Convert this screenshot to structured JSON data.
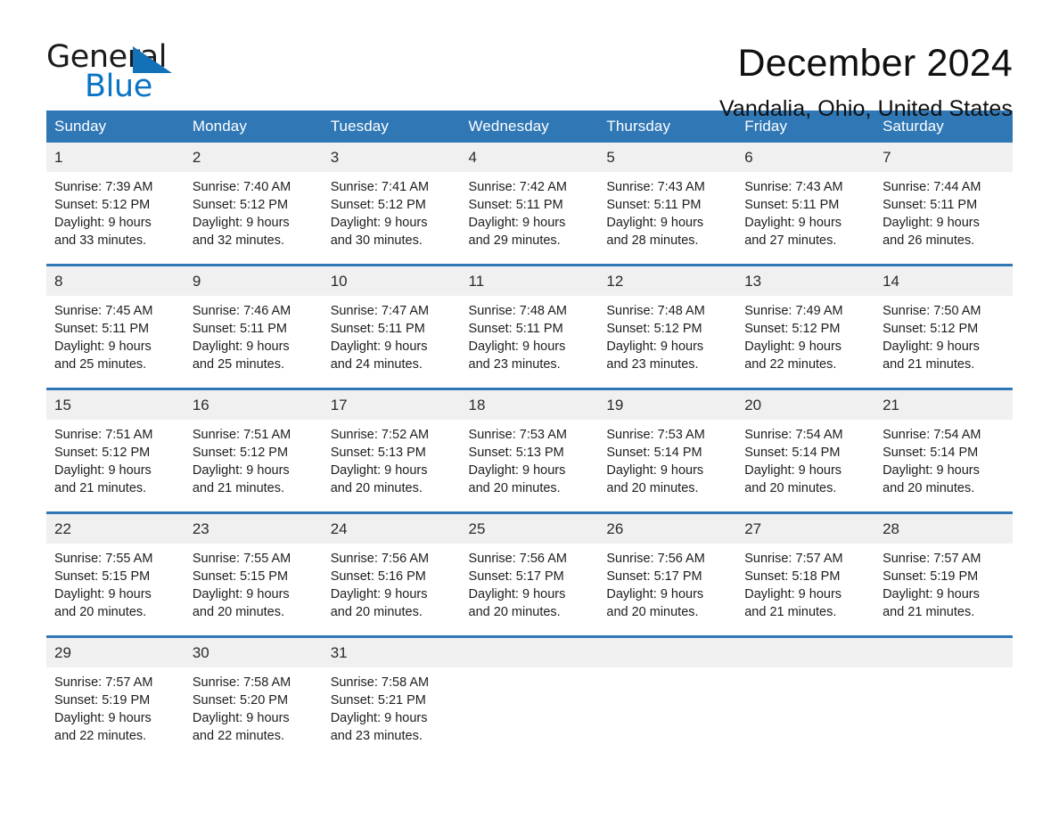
{
  "brand": {
    "name_part1": "General",
    "name_part2": "Blue",
    "triangle_color": "#1371b8",
    "blue_text_color": "#0b74c4"
  },
  "header": {
    "title": "December 2024",
    "subtitle": "Vandalia, Ohio, United States"
  },
  "theme": {
    "header_blue": "#2f77b5",
    "daynum_band": "#f0f0f0",
    "row_divider": "#2f77b5"
  },
  "calendar": {
    "weekday_headers": [
      "Sunday",
      "Monday",
      "Tuesday",
      "Wednesday",
      "Thursday",
      "Friday",
      "Saturday"
    ],
    "weeks": [
      [
        {
          "day": "1",
          "sunrise": "Sunrise: 7:39 AM",
          "sunset": "Sunset: 5:12 PM",
          "daylight1": "Daylight: 9 hours",
          "daylight2": "and 33 minutes."
        },
        {
          "day": "2",
          "sunrise": "Sunrise: 7:40 AM",
          "sunset": "Sunset: 5:12 PM",
          "daylight1": "Daylight: 9 hours",
          "daylight2": "and 32 minutes."
        },
        {
          "day": "3",
          "sunrise": "Sunrise: 7:41 AM",
          "sunset": "Sunset: 5:12 PM",
          "daylight1": "Daylight: 9 hours",
          "daylight2": "and 30 minutes."
        },
        {
          "day": "4",
          "sunrise": "Sunrise: 7:42 AM",
          "sunset": "Sunset: 5:11 PM",
          "daylight1": "Daylight: 9 hours",
          "daylight2": "and 29 minutes."
        },
        {
          "day": "5",
          "sunrise": "Sunrise: 7:43 AM",
          "sunset": "Sunset: 5:11 PM",
          "daylight1": "Daylight: 9 hours",
          "daylight2": "and 28 minutes."
        },
        {
          "day": "6",
          "sunrise": "Sunrise: 7:43 AM",
          "sunset": "Sunset: 5:11 PM",
          "daylight1": "Daylight: 9 hours",
          "daylight2": "and 27 minutes."
        },
        {
          "day": "7",
          "sunrise": "Sunrise: 7:44 AM",
          "sunset": "Sunset: 5:11 PM",
          "daylight1": "Daylight: 9 hours",
          "daylight2": "and 26 minutes."
        }
      ],
      [
        {
          "day": "8",
          "sunrise": "Sunrise: 7:45 AM",
          "sunset": "Sunset: 5:11 PM",
          "daylight1": "Daylight: 9 hours",
          "daylight2": "and 25 minutes."
        },
        {
          "day": "9",
          "sunrise": "Sunrise: 7:46 AM",
          "sunset": "Sunset: 5:11 PM",
          "daylight1": "Daylight: 9 hours",
          "daylight2": "and 25 minutes."
        },
        {
          "day": "10",
          "sunrise": "Sunrise: 7:47 AM",
          "sunset": "Sunset: 5:11 PM",
          "daylight1": "Daylight: 9 hours",
          "daylight2": "and 24 minutes."
        },
        {
          "day": "11",
          "sunrise": "Sunrise: 7:48 AM",
          "sunset": "Sunset: 5:11 PM",
          "daylight1": "Daylight: 9 hours",
          "daylight2": "and 23 minutes."
        },
        {
          "day": "12",
          "sunrise": "Sunrise: 7:48 AM",
          "sunset": "Sunset: 5:12 PM",
          "daylight1": "Daylight: 9 hours",
          "daylight2": "and 23 minutes."
        },
        {
          "day": "13",
          "sunrise": "Sunrise: 7:49 AM",
          "sunset": "Sunset: 5:12 PM",
          "daylight1": "Daylight: 9 hours",
          "daylight2": "and 22 minutes."
        },
        {
          "day": "14",
          "sunrise": "Sunrise: 7:50 AM",
          "sunset": "Sunset: 5:12 PM",
          "daylight1": "Daylight: 9 hours",
          "daylight2": "and 21 minutes."
        }
      ],
      [
        {
          "day": "15",
          "sunrise": "Sunrise: 7:51 AM",
          "sunset": "Sunset: 5:12 PM",
          "daylight1": "Daylight: 9 hours",
          "daylight2": "and 21 minutes."
        },
        {
          "day": "16",
          "sunrise": "Sunrise: 7:51 AM",
          "sunset": "Sunset: 5:12 PM",
          "daylight1": "Daylight: 9 hours",
          "daylight2": "and 21 minutes."
        },
        {
          "day": "17",
          "sunrise": "Sunrise: 7:52 AM",
          "sunset": "Sunset: 5:13 PM",
          "daylight1": "Daylight: 9 hours",
          "daylight2": "and 20 minutes."
        },
        {
          "day": "18",
          "sunrise": "Sunrise: 7:53 AM",
          "sunset": "Sunset: 5:13 PM",
          "daylight1": "Daylight: 9 hours",
          "daylight2": "and 20 minutes."
        },
        {
          "day": "19",
          "sunrise": "Sunrise: 7:53 AM",
          "sunset": "Sunset: 5:14 PM",
          "daylight1": "Daylight: 9 hours",
          "daylight2": "and 20 minutes."
        },
        {
          "day": "20",
          "sunrise": "Sunrise: 7:54 AM",
          "sunset": "Sunset: 5:14 PM",
          "daylight1": "Daylight: 9 hours",
          "daylight2": "and 20 minutes."
        },
        {
          "day": "21",
          "sunrise": "Sunrise: 7:54 AM",
          "sunset": "Sunset: 5:14 PM",
          "daylight1": "Daylight: 9 hours",
          "daylight2": "and 20 minutes."
        }
      ],
      [
        {
          "day": "22",
          "sunrise": "Sunrise: 7:55 AM",
          "sunset": "Sunset: 5:15 PM",
          "daylight1": "Daylight: 9 hours",
          "daylight2": "and 20 minutes."
        },
        {
          "day": "23",
          "sunrise": "Sunrise: 7:55 AM",
          "sunset": "Sunset: 5:15 PM",
          "daylight1": "Daylight: 9 hours",
          "daylight2": "and 20 minutes."
        },
        {
          "day": "24",
          "sunrise": "Sunrise: 7:56 AM",
          "sunset": "Sunset: 5:16 PM",
          "daylight1": "Daylight: 9 hours",
          "daylight2": "and 20 minutes."
        },
        {
          "day": "25",
          "sunrise": "Sunrise: 7:56 AM",
          "sunset": "Sunset: 5:17 PM",
          "daylight1": "Daylight: 9 hours",
          "daylight2": "and 20 minutes."
        },
        {
          "day": "26",
          "sunrise": "Sunrise: 7:56 AM",
          "sunset": "Sunset: 5:17 PM",
          "daylight1": "Daylight: 9 hours",
          "daylight2": "and 20 minutes."
        },
        {
          "day": "27",
          "sunrise": "Sunrise: 7:57 AM",
          "sunset": "Sunset: 5:18 PM",
          "daylight1": "Daylight: 9 hours",
          "daylight2": "and 21 minutes."
        },
        {
          "day": "28",
          "sunrise": "Sunrise: 7:57 AM",
          "sunset": "Sunset: 5:19 PM",
          "daylight1": "Daylight: 9 hours",
          "daylight2": "and 21 minutes."
        }
      ],
      [
        {
          "day": "29",
          "sunrise": "Sunrise: 7:57 AM",
          "sunset": "Sunset: 5:19 PM",
          "daylight1": "Daylight: 9 hours",
          "daylight2": "and 22 minutes."
        },
        {
          "day": "30",
          "sunrise": "Sunrise: 7:58 AM",
          "sunset": "Sunset: 5:20 PM",
          "daylight1": "Daylight: 9 hours",
          "daylight2": "and 22 minutes."
        },
        {
          "day": "31",
          "sunrise": "Sunrise: 7:58 AM",
          "sunset": "Sunset: 5:21 PM",
          "daylight1": "Daylight: 9 hours",
          "daylight2": "and 23 minutes."
        },
        {
          "day": "",
          "sunrise": "",
          "sunset": "",
          "daylight1": "",
          "daylight2": ""
        },
        {
          "day": "",
          "sunrise": "",
          "sunset": "",
          "daylight1": "",
          "daylight2": ""
        },
        {
          "day": "",
          "sunrise": "",
          "sunset": "",
          "daylight1": "",
          "daylight2": ""
        },
        {
          "day": "",
          "sunrise": "",
          "sunset": "",
          "daylight1": "",
          "daylight2": ""
        }
      ]
    ]
  }
}
